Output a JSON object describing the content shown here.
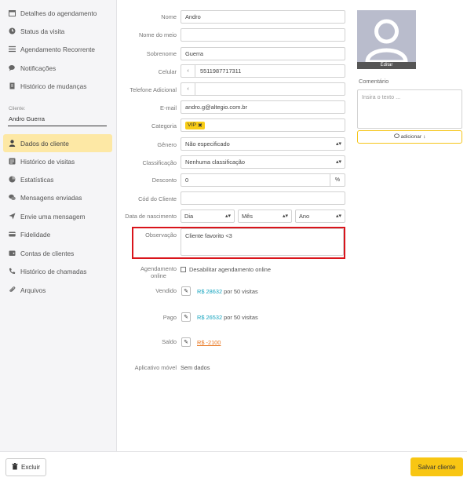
{
  "sidebar": {
    "items_top": [
      {
        "label": "Detalhes do agendamento",
        "icon": "calendar-icon"
      },
      {
        "label": "Status da visita",
        "icon": "clock-icon"
      },
      {
        "label": "Agendamento Recorrente",
        "icon": "list-icon"
      },
      {
        "label": "Notificações",
        "icon": "chat-icon"
      },
      {
        "label": "Histórico de mudanças",
        "icon": "document-icon"
      }
    ],
    "client_label": "Cliente:",
    "client_name": "Andro  Guerra",
    "items_bottom": [
      {
        "label": "Dados do cliente",
        "icon": "user-icon"
      },
      {
        "label": "Histórico de visitas",
        "icon": "history-icon"
      },
      {
        "label": "Estatísticas",
        "icon": "pie-chart-icon"
      },
      {
        "label": "Mensagens enviadas",
        "icon": "messages-icon"
      },
      {
        "label": "Envie uma mensagem",
        "icon": "send-icon"
      },
      {
        "label": "Fidelidade",
        "icon": "card-icon"
      },
      {
        "label": "Contas de clientes",
        "icon": "wallet-icon"
      },
      {
        "label": "Histórico de chamadas",
        "icon": "phone-icon"
      },
      {
        "label": "Arquivos",
        "icon": "paperclip-icon"
      }
    ]
  },
  "form": {
    "nome": {
      "label": "Nome",
      "value": "Andro"
    },
    "nome_meio": {
      "label": "Nome do meio",
      "value": ""
    },
    "sobrenome": {
      "label": "Sobrenome",
      "value": "Guerra"
    },
    "celular": {
      "label": "Celular",
      "value": "5511987717311",
      "flag": "‹"
    },
    "telefone": {
      "label": "Telefone Adicional",
      "value": "",
      "flag": "‹"
    },
    "email": {
      "label": "E-mail",
      "value": "andro.g@altegio.com.br"
    },
    "categoria": {
      "label": "Categoria",
      "tag": "VIP",
      "tag_close": "✖"
    },
    "genero": {
      "label": "Gênero",
      "value": "Não especificado"
    },
    "classificacao": {
      "label": "Classificação",
      "value": "Nenhuma classificação"
    },
    "desconto": {
      "label": "Desconto",
      "value": "0",
      "unit": "%"
    },
    "cod_cliente": {
      "label": "Cód do Cliente",
      "value": ""
    },
    "nascimento": {
      "label": "Data de nascimento",
      "dia": "Dia",
      "mes": "Mês",
      "ano": "Ano"
    },
    "observacao": {
      "label": "Observação",
      "value": "Cliente favorito <3"
    },
    "agendamento_online": {
      "label_1": "Agendamento",
      "label_2": "online",
      "checkbox_label": "Desabilitar agendamento online",
      "checked": false
    },
    "vendido": {
      "label": "Vendido",
      "amount": "R$ 28632",
      "suffix": "por 50 visitas"
    },
    "pago": {
      "label": "Pago",
      "amount": "R$ 26532",
      "suffix": "por 50 visitas"
    },
    "saldo": {
      "label": "Saldo",
      "amount": "R$ -2100"
    },
    "aplicativo": {
      "label": "Aplicativo móvel",
      "value": "Sem dados"
    }
  },
  "right": {
    "avatar_edit": "Editar",
    "comment_label": "Comentário",
    "comment_placeholder": "Insira o texto ...",
    "add_button": "adicionar",
    "add_icon": "chat-icon"
  },
  "footer": {
    "delete_label": "Excluir",
    "save_label": "Salvar cliente"
  },
  "colors": {
    "accent_yellow": "#f8c613",
    "active_nav": "#fde8a5",
    "highlight_red": "#d9141b",
    "money_blue": "#15a4bf",
    "money_negative": "#e8741c"
  }
}
